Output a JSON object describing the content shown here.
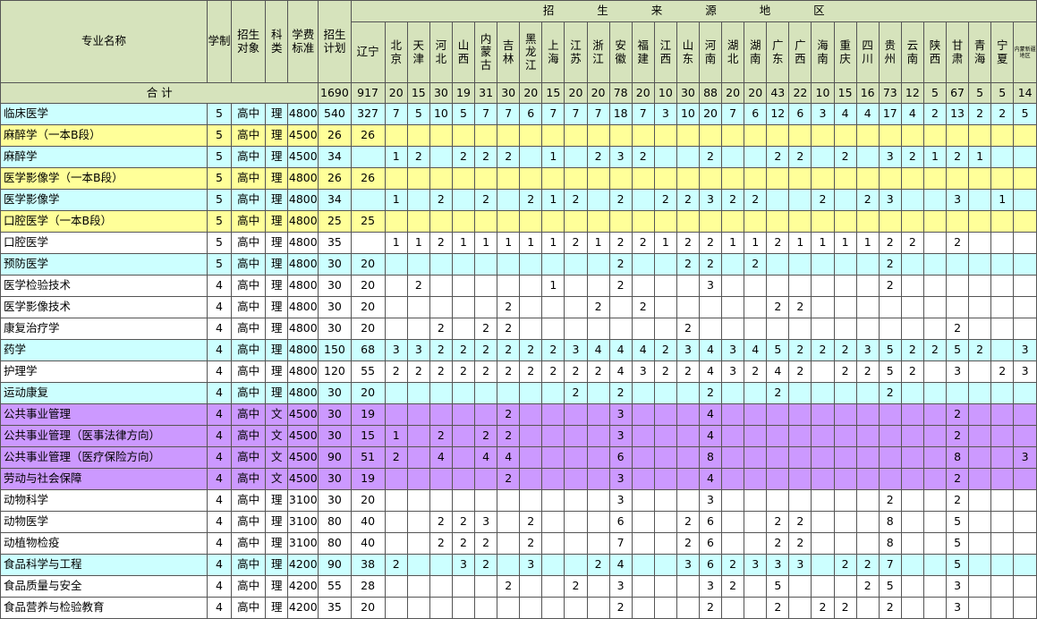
{
  "headers": {
    "major": "专业名称",
    "duration": "学制",
    "target": "招生对象",
    "category": "科类",
    "fee": "学费标准",
    "plan": "招生计划",
    "region_group": "招 生 来 源 地 区",
    "regions": [
      "辽宁",
      "北京",
      "天津",
      "河北",
      "山西",
      "内蒙古",
      "吉林",
      "黑龙江",
      "上海",
      "江苏",
      "浙江",
      "安徽",
      "福建",
      "江西",
      "山东",
      "河南",
      "湖北",
      "湖南",
      "广东",
      "广西",
      "海南",
      "重庆",
      "四川",
      "贵州",
      "云南",
      "陕西",
      "甘肃",
      "青海",
      "宁夏",
      "内蒙新疆地区"
    ]
  },
  "total": {
    "label": "合      计",
    "plan": "1690",
    "cells": [
      "917",
      "20",
      "15",
      "30",
      "19",
      "31",
      "30",
      "20",
      "15",
      "20",
      "20",
      "78",
      "20",
      "10",
      "30",
      "88",
      "20",
      "20",
      "43",
      "22",
      "10",
      "15",
      "16",
      "73",
      "12",
      "5",
      "67",
      "5",
      "5",
      "14"
    ]
  },
  "rows": [
    {
      "name": "临床医学",
      "duration": "5",
      "target": "高中",
      "category": "理",
      "fee": "4800",
      "plan": "540",
      "color": "cyan",
      "cells": [
        "327",
        "7",
        "5",
        "10",
        "5",
        "7",
        "7",
        "6",
        "7",
        "7",
        "7",
        "18",
        "7",
        "3",
        "10",
        "20",
        "7",
        "6",
        "12",
        "6",
        "3",
        "4",
        "4",
        "17",
        "4",
        "2",
        "13",
        "2",
        "2",
        "5"
      ]
    },
    {
      "name": "麻醉学（一本B段）",
      "duration": "5",
      "target": "高中",
      "category": "理",
      "fee": "4500",
      "plan": "26",
      "color": "yellow",
      "cells": [
        "26",
        "",
        "",
        "",
        "",
        "",
        "",
        "",
        "",
        "",
        "",
        "",
        "",
        "",
        "",
        "",
        "",
        "",
        "",
        "",
        "",
        "",
        "",
        "",
        "",
        "",
        "",
        "",
        "",
        ""
      ]
    },
    {
      "name": "麻醉学",
      "duration": "5",
      "target": "高中",
      "category": "理",
      "fee": "4500",
      "plan": "34",
      "color": "cyan",
      "cells": [
        "",
        "1",
        "2",
        "",
        "2",
        "2",
        "2",
        "",
        "1",
        "",
        "2",
        "3",
        "2",
        "",
        "",
        "2",
        "",
        "",
        "2",
        "2",
        "",
        "2",
        "",
        "3",
        "2",
        "1",
        "2",
        "1",
        "",
        ""
      ]
    },
    {
      "name": "医学影像学（一本B段）",
      "duration": "5",
      "target": "高中",
      "category": "理",
      "fee": "4800",
      "plan": "26",
      "color": "yellow",
      "cells": [
        "26",
        "",
        "",
        "",
        "",
        "",
        "",
        "",
        "",
        "",
        "",
        "",
        "",
        "",
        "",
        "",
        "",
        "",
        "",
        "",
        "",
        "",
        "",
        "",
        "",
        "",
        "",
        "",
        "",
        ""
      ]
    },
    {
      "name": "医学影像学",
      "duration": "5",
      "target": "高中",
      "category": "理",
      "fee": "4800",
      "plan": "34",
      "color": "cyan",
      "cells": [
        "",
        "1",
        "",
        "2",
        "",
        "2",
        "",
        "2",
        "1",
        "2",
        "",
        "2",
        "",
        "2",
        "2",
        "3",
        "2",
        "2",
        "",
        "",
        "2",
        "",
        "2",
        "3",
        "",
        "",
        "3",
        "",
        "1",
        ""
      ]
    },
    {
      "name": "口腔医学（一本B段）",
      "duration": "5",
      "target": "高中",
      "category": "理",
      "fee": "4800",
      "plan": "25",
      "color": "yellow",
      "cells": [
        "25",
        "",
        "",
        "",
        "",
        "",
        "",
        "",
        "",
        "",
        "",
        "",
        "",
        "",
        "",
        "",
        "",
        "",
        "",
        "",
        "",
        "",
        "",
        "",
        "",
        "",
        "",
        "",
        "",
        ""
      ]
    },
    {
      "name": "口腔医学",
      "duration": "5",
      "target": "高中",
      "category": "理",
      "fee": "4800",
      "plan": "35",
      "color": "white",
      "cells": [
        "",
        "1",
        "1",
        "2",
        "1",
        "1",
        "1",
        "1",
        "1",
        "2",
        "1",
        "2",
        "2",
        "1",
        "2",
        "2",
        "1",
        "1",
        "2",
        "1",
        "1",
        "1",
        "1",
        "2",
        "2",
        "",
        "2",
        "",
        "",
        ""
      ]
    },
    {
      "name": "预防医学",
      "duration": "5",
      "target": "高中",
      "category": "理",
      "fee": "4800",
      "plan": "30",
      "color": "cyan",
      "cells": [
        "20",
        "",
        "",
        "",
        "",
        "",
        "",
        "",
        "",
        "",
        "",
        "2",
        "",
        "",
        "2",
        "2",
        "",
        "2",
        "",
        "",
        "",
        "",
        "",
        "2",
        "",
        "",
        "",
        "",
        "",
        ""
      ]
    },
    {
      "name": "医学检验技术",
      "duration": "4",
      "target": "高中",
      "category": "理",
      "fee": "4800",
      "plan": "30",
      "color": "white",
      "cells": [
        "20",
        "",
        "2",
        "",
        "",
        "",
        "",
        "",
        "1",
        "",
        "",
        "2",
        "",
        "",
        "",
        "3",
        "",
        "",
        "",
        "",
        "",
        "",
        "",
        "2",
        "",
        "",
        "",
        "",
        "",
        ""
      ]
    },
    {
      "name": "医学影像技术",
      "duration": "4",
      "target": "高中",
      "category": "理",
      "fee": "4800",
      "plan": "30",
      "color": "white",
      "cells": [
        "20",
        "",
        "",
        "",
        "",
        "",
        "2",
        "",
        "",
        "",
        "2",
        "",
        "2",
        "",
        "",
        "",
        "",
        "",
        "2",
        "2",
        "",
        "",
        "",
        "",
        "",
        "",
        "",
        "",
        "",
        ""
      ]
    },
    {
      "name": "康复治疗学",
      "duration": "4",
      "target": "高中",
      "category": "理",
      "fee": "4800",
      "plan": "30",
      "color": "white",
      "cells": [
        "20",
        "",
        "",
        "2",
        "",
        "2",
        "2",
        "",
        "",
        "",
        "",
        "",
        "",
        "",
        "2",
        "",
        "",
        "",
        "",
        "",
        "",
        "",
        "",
        "",
        "",
        "",
        "2",
        "",
        "",
        ""
      ]
    },
    {
      "name": "药学",
      "duration": "4",
      "target": "高中",
      "category": "理",
      "fee": "4800",
      "plan": "150",
      "color": "cyan",
      "cells": [
        "68",
        "3",
        "3",
        "2",
        "2",
        "2",
        "2",
        "2",
        "2",
        "3",
        "4",
        "4",
        "4",
        "2",
        "3",
        "4",
        "3",
        "4",
        "5",
        "2",
        "2",
        "2",
        "3",
        "5",
        "2",
        "2",
        "5",
        "2",
        "",
        "3"
      ]
    },
    {
      "name": "护理学",
      "duration": "4",
      "target": "高中",
      "category": "理",
      "fee": "4800",
      "plan": "120",
      "color": "white",
      "cells": [
        "55",
        "2",
        "2",
        "2",
        "2",
        "2",
        "2",
        "2",
        "2",
        "2",
        "2",
        "4",
        "3",
        "2",
        "2",
        "4",
        "3",
        "2",
        "4",
        "2",
        "",
        "2",
        "2",
        "5",
        "2",
        "",
        "3",
        "",
        "2",
        "3"
      ]
    },
    {
      "name": "运动康复",
      "duration": "4",
      "target": "高中",
      "category": "理",
      "fee": "4800",
      "plan": "30",
      "color": "cyan",
      "cells": [
        "20",
        "",
        "",
        "",
        "",
        "",
        "",
        "",
        "",
        "2",
        "",
        "2",
        "",
        "",
        "",
        "2",
        "",
        "",
        "2",
        "",
        "",
        "",
        "",
        "2",
        "",
        "",
        "",
        "",
        "",
        ""
      ]
    },
    {
      "name": "公共事业管理",
      "duration": "4",
      "target": "高中",
      "category": "文",
      "fee": "4500",
      "plan": "30",
      "color": "purple",
      "cells": [
        "19",
        "",
        "",
        "",
        "",
        "",
        "2",
        "",
        "",
        "",
        "",
        "3",
        "",
        "",
        "",
        "4",
        "",
        "",
        "",
        "",
        "",
        "",
        "",
        "",
        "",
        "",
        "2",
        "",
        "",
        ""
      ]
    },
    {
      "name": "公共事业管理（医事法律方向）",
      "duration": "4",
      "target": "高中",
      "category": "文",
      "fee": "4500",
      "plan": "30",
      "color": "purple",
      "cells": [
        "15",
        "1",
        "",
        "2",
        "",
        "2",
        "2",
        "",
        "",
        "",
        "",
        "3",
        "",
        "",
        "",
        "4",
        "",
        "",
        "",
        "",
        "",
        "",
        "",
        "",
        "",
        "",
        "2",
        "",
        "",
        ""
      ]
    },
    {
      "name": "公共事业管理（医疗保险方向）",
      "duration": "4",
      "target": "高中",
      "category": "文",
      "fee": "4500",
      "plan": "90",
      "color": "purple",
      "cells": [
        "51",
        "2",
        "",
        "4",
        "",
        "4",
        "4",
        "",
        "",
        "",
        "",
        "6",
        "",
        "",
        "",
        "8",
        "",
        "",
        "",
        "",
        "",
        "",
        "",
        "",
        "",
        "",
        "8",
        "",
        "",
        "3"
      ]
    },
    {
      "name": "劳动与社会保障",
      "duration": "4",
      "target": "高中",
      "category": "文",
      "fee": "4500",
      "plan": "30",
      "color": "purple",
      "cells": [
        "19",
        "",
        "",
        "",
        "",
        "",
        "2",
        "",
        "",
        "",
        "",
        "3",
        "",
        "",
        "",
        "4",
        "",
        "",
        "",
        "",
        "",
        "",
        "",
        "",
        "",
        "",
        "2",
        "",
        "",
        ""
      ]
    },
    {
      "name": "动物科学",
      "duration": "4",
      "target": "高中",
      "category": "理",
      "fee": "3100",
      "plan": "30",
      "color": "white",
      "cells": [
        "20",
        "",
        "",
        "",
        "",
        "",
        "",
        "",
        "",
        "",
        "",
        "3",
        "",
        "",
        "",
        "3",
        "",
        "",
        "",
        "",
        "",
        "",
        "",
        "2",
        "",
        "",
        "2",
        "",
        "",
        ""
      ]
    },
    {
      "name": "动物医学",
      "duration": "4",
      "target": "高中",
      "category": "理",
      "fee": "3100",
      "plan": "80",
      "color": "white",
      "cells": [
        "40",
        "",
        "",
        "2",
        "2",
        "3",
        "",
        "2",
        "",
        "",
        "",
        "6",
        "",
        "",
        "2",
        "6",
        "",
        "",
        "2",
        "2",
        "",
        "",
        "",
        "8",
        "",
        "",
        "5",
        "",
        "",
        ""
      ]
    },
    {
      "name": "动植物检疫",
      "duration": "4",
      "target": "高中",
      "category": "理",
      "fee": "3100",
      "plan": "80",
      "color": "white",
      "cells": [
        "40",
        "",
        "",
        "2",
        "2",
        "2",
        "",
        "2",
        "",
        "",
        "",
        "7",
        "",
        "",
        "2",
        "6",
        "",
        "",
        "2",
        "2",
        "",
        "",
        "",
        "8",
        "",
        "",
        "5",
        "",
        "",
        ""
      ]
    },
    {
      "name": "食品科学与工程",
      "duration": "4",
      "target": "高中",
      "category": "理",
      "fee": "4200",
      "plan": "90",
      "color": "cyan",
      "cells": [
        "38",
        "2",
        "",
        "",
        "3",
        "2",
        "",
        "3",
        "",
        "",
        "2",
        "4",
        "",
        "",
        "3",
        "6",
        "2",
        "3",
        "3",
        "3",
        "",
        "2",
        "2",
        "7",
        "",
        "",
        "5",
        "",
        "",
        ""
      ]
    },
    {
      "name": "食品质量与安全",
      "duration": "4",
      "target": "高中",
      "category": "理",
      "fee": "4200",
      "plan": "55",
      "color": "white",
      "cells": [
        "28",
        "",
        "",
        "",
        "",
        "",
        "2",
        "",
        "",
        "2",
        "",
        "3",
        "",
        "",
        "",
        "3",
        "2",
        "",
        "5",
        "",
        "",
        "",
        "2",
        "5",
        "",
        "",
        "3",
        "",
        "",
        ""
      ]
    },
    {
      "name": "食品营养与检验教育",
      "duration": "4",
      "target": "高中",
      "category": "理",
      "fee": "4200",
      "plan": "35",
      "color": "white",
      "cells": [
        "20",
        "",
        "",
        "",
        "",
        "",
        "",
        "",
        "",
        "",
        "",
        "2",
        "",
        "",
        "",
        "2",
        "",
        "",
        "2",
        "",
        "2",
        "2",
        "",
        "2",
        "",
        "",
        "3",
        "",
        "",
        ""
      ]
    }
  ]
}
